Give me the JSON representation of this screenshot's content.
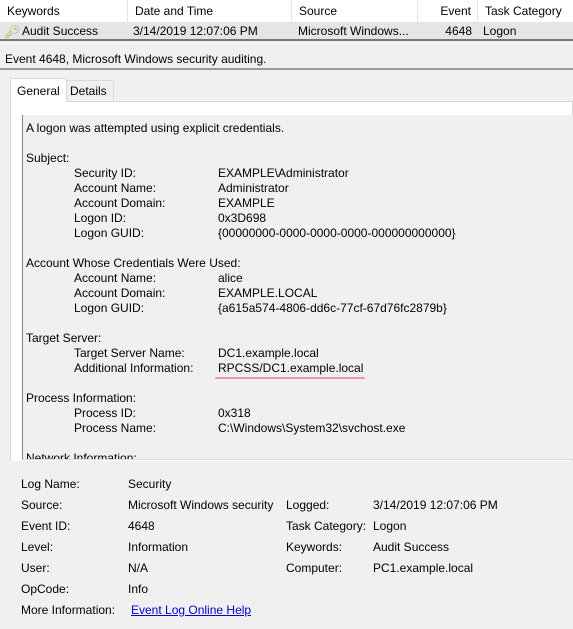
{
  "list": {
    "columns": [
      "Keywords",
      "Date and Time",
      "Source",
      "Event ID",
      "Task Category"
    ],
    "row": {
      "keywords": "Audit Success",
      "date": "3/14/2019 12:07:06 PM",
      "source": "Microsoft Windows...",
      "event_id": "4648",
      "task_category": "Logon",
      "icon": "key-icon"
    }
  },
  "title_bar": "Event 4648, Microsoft Windows security auditing.",
  "tabs": [
    "General",
    "Details"
  ],
  "description": {
    "intro": "A logon was attempted using explicit credentials.",
    "subject": {
      "heading": "Subject:",
      "rows": [
        [
          "Security ID:",
          "EXAMPLE\\Administrator"
        ],
        [
          "Account Name:",
          "Administrator"
        ],
        [
          "Account Domain:",
          "EXAMPLE"
        ],
        [
          "Logon ID:",
          "0x3D698"
        ],
        [
          "Logon GUID:",
          "{00000000-0000-0000-0000-000000000000}"
        ]
      ]
    },
    "account": {
      "heading": "Account Whose Credentials Were Used:",
      "rows": [
        [
          "Account Name:",
          "alice"
        ],
        [
          "Account Domain:",
          "EXAMPLE.LOCAL"
        ],
        [
          "Logon GUID:",
          "{a615a574-4806-dd6c-77cf-67d76fc2879b}"
        ]
      ]
    },
    "target": {
      "heading": "Target Server:",
      "rows": [
        [
          "Target Server Name:",
          "DC1.example.local"
        ],
        [
          "Additional Information:",
          "RPCSS/DC1.example.local"
        ]
      ]
    },
    "process": {
      "heading": "Process Information:",
      "rows": [
        [
          "Process ID:",
          "0x318"
        ],
        [
          "Process Name:",
          "C:\\Windows\\System32\\svchost.exe"
        ]
      ]
    },
    "network": {
      "heading": "Network Information:"
    }
  },
  "fields": {
    "log_name_label": "Log Name:",
    "log_name": "Security",
    "source_label": "Source:",
    "source": "Microsoft Windows security",
    "logged_label": "Logged:",
    "logged": "3/14/2019 12:07:06 PM",
    "event_id_label": "Event ID:",
    "event_id": "4648",
    "task_category_label": "Task Category:",
    "task_category": "Logon",
    "level_label": "Level:",
    "level": "Information",
    "keywords_label": "Keywords:",
    "keywords": "Audit Success",
    "user_label": "User:",
    "user": "N/A",
    "computer_label": "Computer:",
    "computer": "PC1.example.local",
    "opcode_label": "OpCode:",
    "opcode": "Info",
    "more_info_label": "More Information:",
    "more_info_link": "Event Log Online Help"
  },
  "colors": {
    "highlight_underline": "#f08fbf",
    "link": "#0000cc"
  }
}
